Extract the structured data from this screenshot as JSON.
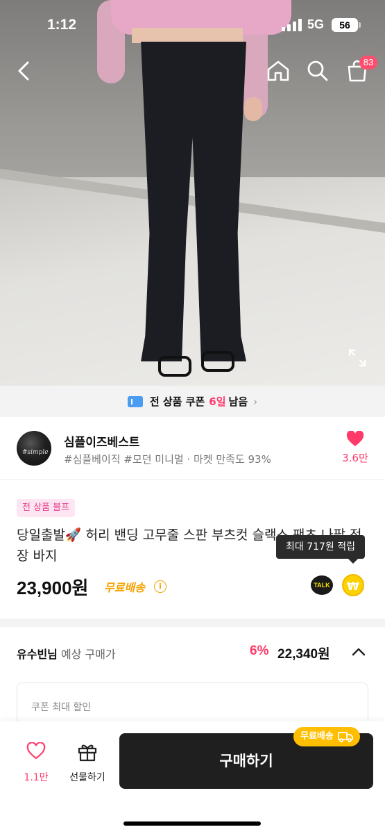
{
  "status": {
    "time": "1:12",
    "network": "5G",
    "battery": "56"
  },
  "header": {
    "cart_count": "83"
  },
  "coupon_banner": {
    "text": "전 상품 쿠폰",
    "highlight": "6일",
    "suffix": "남음"
  },
  "shop": {
    "avatar_text": "#simple",
    "name": "심플이즈베스트",
    "tags": "#심플베이직 #모던 미니멀 · 마켓 만족도 93%",
    "likes": "3.6만"
  },
  "product": {
    "badge": "전 상품 블프",
    "title": "당일출발🚀 허리 밴딩 고무줄 스판 부츠컷 슬랙스 팬츠 나팔 정장 바지",
    "points_tooltip": "최대 717원 적립",
    "price": "23,900원",
    "shipping": "무료배송",
    "talk_label": "TALK",
    "won_symbol": "₩"
  },
  "expected_price": {
    "user": "유수빈님",
    "label": "예상 구매가",
    "discount_rate": "6%",
    "price": "22,340원"
  },
  "coupon_box": {
    "label": "쿠폰 최대 할인"
  },
  "bottom_bar": {
    "like_count": "1.1만",
    "gift_label": "선물하기",
    "buy_label": "구매하기",
    "free_ship_badge": "무료배송"
  },
  "colors": {
    "accent": "#ff3a69",
    "shipping": "#f5a300",
    "buy_button": "#1f1f1f"
  }
}
